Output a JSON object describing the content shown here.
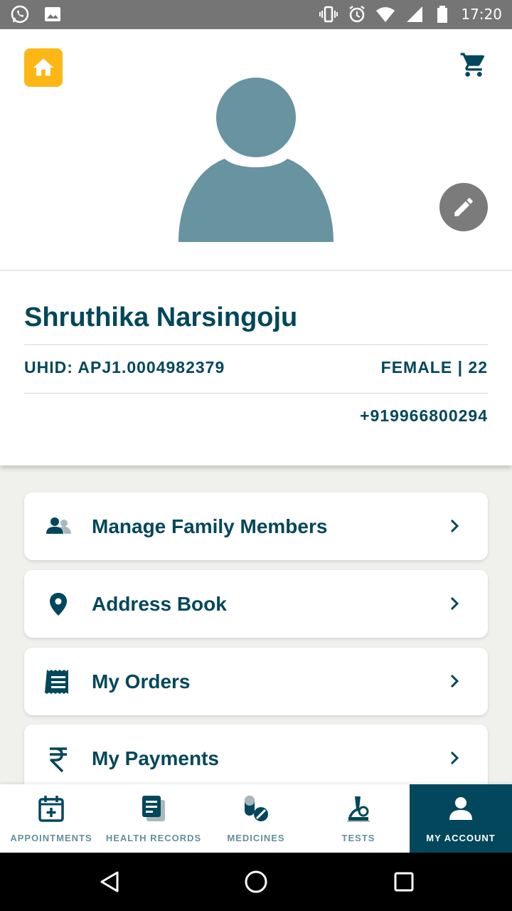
{
  "status_bar": {
    "time": "17:20",
    "left_icons": [
      "whatsapp-icon",
      "image-icon"
    ],
    "right_icons": [
      "vibrate-icon",
      "alarm-icon",
      "wifi-icon",
      "signal-icon",
      "battery-icon"
    ]
  },
  "header": {
    "home_icon": "home-icon",
    "cart_icon": "cart-icon",
    "avatar_icon": "person-avatar",
    "edit_icon": "pencil-icon"
  },
  "profile": {
    "name": "Shruthika Narsingoju",
    "uhid": "UHID: APJ1.0004982379",
    "gender_age": "FEMALE | 22",
    "phone": "+919966800294"
  },
  "menu": {
    "items": [
      {
        "label": "Manage Family Members",
        "icon": "family-icon"
      },
      {
        "label": "Address Book",
        "icon": "location-pin-icon"
      },
      {
        "label": "My Orders",
        "icon": "receipt-icon"
      },
      {
        "label": "My Payments",
        "icon": "rupee-icon"
      }
    ]
  },
  "bottom_nav": {
    "tabs": [
      {
        "label": "APPOINTMENTS",
        "icon": "calendar-plus-icon",
        "active": false
      },
      {
        "label": "HEALTH RECORDS",
        "icon": "records-icon",
        "active": false
      },
      {
        "label": "MEDICINES",
        "icon": "pills-icon",
        "active": false
      },
      {
        "label": "TESTS",
        "icon": "microscope-icon",
        "active": false
      },
      {
        "label": "MY ACCOUNT",
        "icon": "account-icon",
        "active": true
      }
    ]
  },
  "colors": {
    "primary": "#02475b",
    "accent": "#fcb716",
    "avatar": "#6893a0",
    "muted_nav": "#658f9b"
  }
}
